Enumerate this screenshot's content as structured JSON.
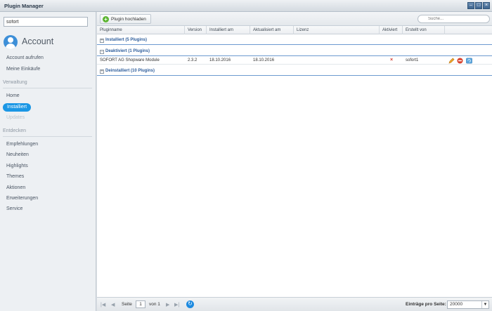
{
  "window": {
    "title": "Plugin Manager"
  },
  "sidebar": {
    "search_value": "sofort",
    "account_title": "Account",
    "account_items": [
      "Account aufrufen",
      "Meine Einkäufe"
    ],
    "section_verwaltung": "Verwaltung",
    "verwaltung_items": [
      "Home",
      "Installiert",
      "Updates"
    ],
    "section_entdecken": "Entdecken",
    "entdecken_items": [
      "Empfehlungen",
      "Neuheiten",
      "Highlights",
      "Themes",
      "Aktionen",
      "Erweiterungen",
      "Service"
    ]
  },
  "toolbar": {
    "upload_label": "Plugin hochladen",
    "search_placeholder": "Suche..."
  },
  "grid": {
    "columns": [
      "Pluginname",
      "Version",
      "Installiert am",
      "Aktualisiert am",
      "Lizenz",
      "Aktiviert",
      "Erstellt von"
    ],
    "groups": [
      "Installiert (5 Plugins)",
      "Deaktiviert (1 Plugins)",
      "Deinstalliert (10 Plugins)"
    ],
    "row": {
      "name": "SOFORT AG Shopware Module",
      "version": "2.3.2",
      "installed": "18.10.2016",
      "updated": "18.10.2016",
      "license": "",
      "active_mark": "×",
      "author": "sofort1"
    }
  },
  "pager": {
    "page_label": "Seite",
    "page_value": "1",
    "of_label": "von 1",
    "per_page_label": "Einträge pro Seite:",
    "per_page_value": "20000"
  }
}
